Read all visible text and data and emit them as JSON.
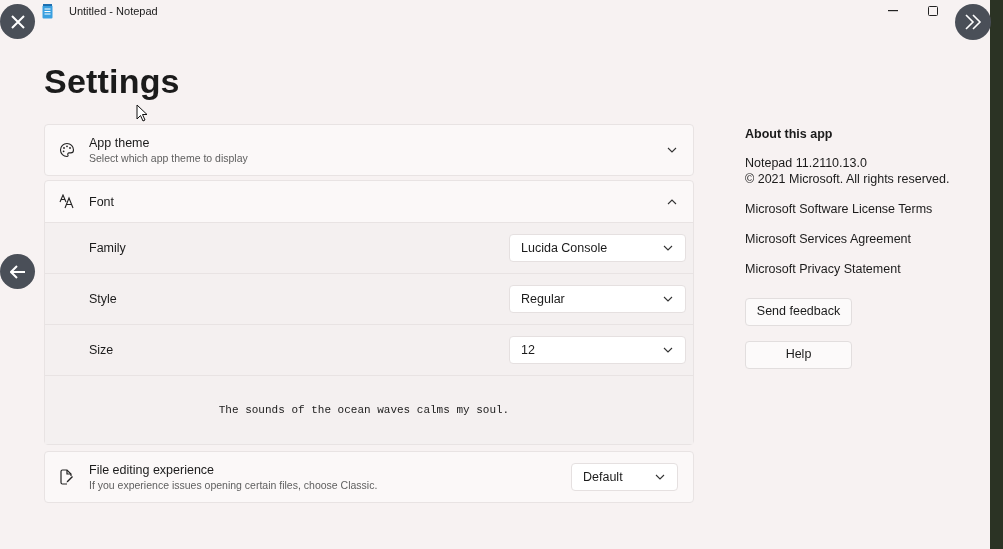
{
  "window": {
    "title": "Untitled - Notepad"
  },
  "heading": "Settings",
  "sections": [
    {
      "kind": "expander",
      "title": "App theme",
      "subtitle": "Select which app theme to display",
      "expanded": false
    },
    {
      "kind": "expander",
      "title": "Font",
      "expanded": true,
      "rows": [
        {
          "label": "Family",
          "value": "Lucida Console"
        },
        {
          "label": "Style",
          "value": "Regular"
        },
        {
          "label": "Size",
          "value": "12"
        }
      ],
      "preview": "The sounds of the ocean waves calms my soul."
    },
    {
      "kind": "dropdown",
      "title": "File editing experience",
      "subtitle": "If you experience issues opening certain files, choose Classic.",
      "value": "Default"
    }
  ],
  "about": {
    "title": "About this app",
    "version": "Notepad 11.2110.13.0",
    "copyright": "© 2021 Microsoft. All rights reserved.",
    "links": [
      "Microsoft Software License Terms",
      "Microsoft Services Agreement",
      "Microsoft Privacy Statement"
    ],
    "buttons": [
      "Send feedback",
      "Help"
    ]
  }
}
